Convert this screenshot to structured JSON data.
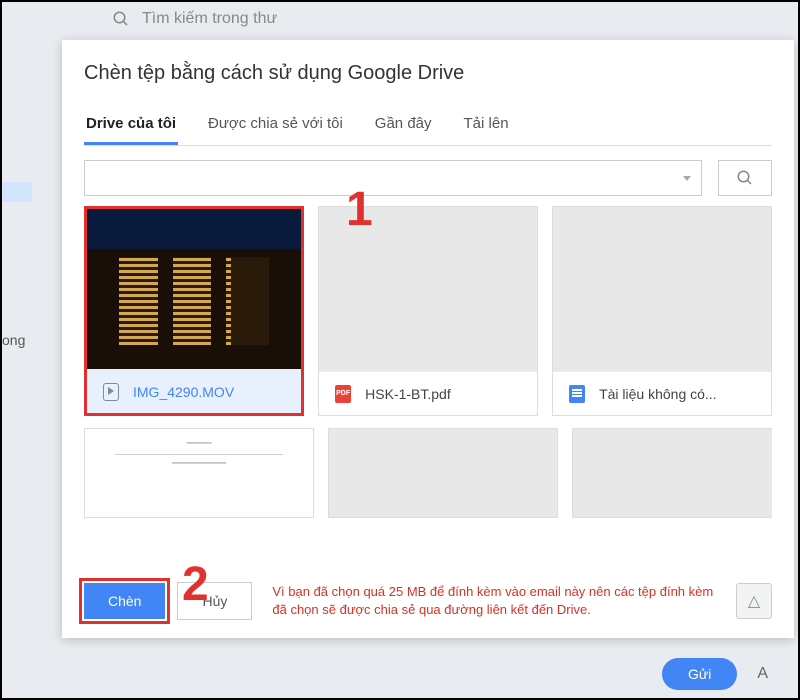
{
  "backdrop": {
    "search_placeholder": "Tìm kiếm trong thư",
    "side_text": "ong",
    "send_label": "Gửi",
    "attach_label": "A"
  },
  "dialog": {
    "title": "Chèn tệp bằng cách sử dụng Google Drive",
    "tabs": [
      {
        "label": "Drive của tôi",
        "active": true
      },
      {
        "label": "Được chia sẻ với tôi",
        "active": false
      },
      {
        "label": "Gần đây",
        "active": false
      },
      {
        "label": "Tải lên",
        "active": false
      }
    ],
    "files": [
      {
        "name": "IMG_4290.MOV",
        "type": "mov",
        "selected": true
      },
      {
        "name": "HSK-1-BT.pdf",
        "type": "pdf",
        "selected": false
      },
      {
        "name": "Tài liệu không có...",
        "type": "doc",
        "selected": false
      }
    ],
    "pdf_badge": "PDF",
    "insert_label": "Chèn",
    "cancel_label": "Hủy",
    "warning_text": "Vì bạn đã chọn quá 25 MB để đính kèm vào email này nên các tệp đính kèm đã chọn sẽ được chia sẻ qua đường liên kết đến Drive.",
    "drive_icon": "△"
  },
  "annotations": {
    "one": "1",
    "two": "2"
  }
}
